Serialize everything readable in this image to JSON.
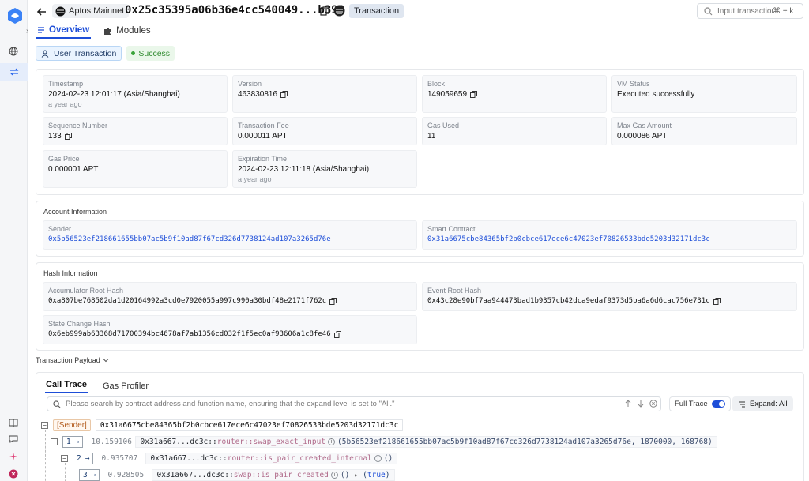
{
  "header": {
    "network": "Aptos Mainnet",
    "tx_hash_short": "0x25c35395a06b36e4cc540049...b398",
    "tx_type_badge": "Transaction",
    "search_placeholder": "Input transaction",
    "search_shortcut": "⌘ + k",
    "tabs": [
      {
        "label": "Overview",
        "active": true
      },
      {
        "label": "Modules",
        "active": false
      }
    ]
  },
  "badges": {
    "user_transaction": "User Transaction",
    "status": "Success"
  },
  "overview": {
    "timestamp": {
      "label": "Timestamp",
      "value": "2024-02-23 12:01:17 (Asia/Shanghai)",
      "relative": "a year ago"
    },
    "version": {
      "label": "Version",
      "value": "463830816"
    },
    "block": {
      "label": "Block",
      "value": "149059659"
    },
    "vm_status": {
      "label": "VM Status",
      "value": "Executed successfully"
    },
    "sequence_number": {
      "label": "Sequence Number",
      "value": "133"
    },
    "transaction_fee": {
      "label": "Transaction Fee",
      "value": "0.000011 APT"
    },
    "gas_used": {
      "label": "Gas Used",
      "value": "11"
    },
    "max_gas_amount": {
      "label": "Max Gas Amount",
      "value": "0.000086 APT"
    },
    "gas_price": {
      "label": "Gas Price",
      "value": "0.000001 APT"
    },
    "expiration_time": {
      "label": "Expiration Time",
      "value": "2024-02-23 12:11:18 (Asia/Shanghai)",
      "relative": "a year ago"
    }
  },
  "account_info": {
    "title": "Account Information",
    "sender": {
      "label": "Sender",
      "value": "0x5b56523ef218661655bb07ac5b9f10ad87f67cd326d7738124ad107a3265d76e"
    },
    "smart_contract": {
      "label": "Smart Contract",
      "value": "0x31a6675cbe84365bf2b0cbce617ece6c47023ef70826533bde5203d32171dc3c"
    }
  },
  "hash_info": {
    "title": "Hash Information",
    "accumulator_root": {
      "label": "Accumulator Root Hash",
      "value": "0xa807be768502da1d20164992a3cd0e7920055a997c990a30bdf48e2171f762c"
    },
    "event_root": {
      "label": "Event Root Hash",
      "value": "0x43c28e90bf7aa944473bad1b9357cb42dca9edaf9373d5ba6a6d6cac756e731c"
    },
    "state_change": {
      "label": "State Change Hash",
      "value": "0x6eb999ab63368d71700394bc4678af7ab1356cd032f1f5ec0af93606a1c8fe46"
    }
  },
  "payload": {
    "title": "Transaction Payload",
    "tabs": [
      {
        "label": "Call Trace",
        "active": true
      },
      {
        "label": "Gas Profiler",
        "active": false
      }
    ],
    "search_placeholder": "Please search by contract address and function name, ensuring that the expand level is set to \"All.\"",
    "full_trace_label": "Full Trace",
    "full_trace_on": true,
    "expand_label": "Expand: All",
    "sender_tag": "[Sender]",
    "sender_address": "0x31a6675cbe84365bf2b0cbce617ece6c47023ef70826533bde5203d32171dc3c",
    "rows": [
      {
        "depth": "1",
        "gas": "10.159106",
        "addr": "0x31a667...dc3c",
        "sep1": "::",
        "module": "router",
        "sep2": "::",
        "func": "swap_exact_input",
        "args": "(5b56523ef218661655bb07ac5b9f10ad87f67cd326d7738124ad107a3265d76e,  1870000,  168768)",
        "ret": ""
      },
      {
        "depth": "2",
        "gas": "0.935707",
        "addr": "0x31a667...dc3c",
        "sep1": "::",
        "module": "router",
        "sep2": "::",
        "func": "is_pair_created_internal",
        "args": "()",
        "ret": ""
      },
      {
        "depth": "3",
        "gas": "0.928505",
        "addr": "0x31a667...dc3c",
        "sep1": "::",
        "module": "swap",
        "sep2": "::",
        "func": "is_pair_created",
        "args": "()",
        "ret": "(true)"
      }
    ]
  },
  "colors": {
    "accent": "#1d4ed8",
    "success": "#2f8a2f",
    "sender": "#b35c1e",
    "module": "#b06a8a"
  }
}
